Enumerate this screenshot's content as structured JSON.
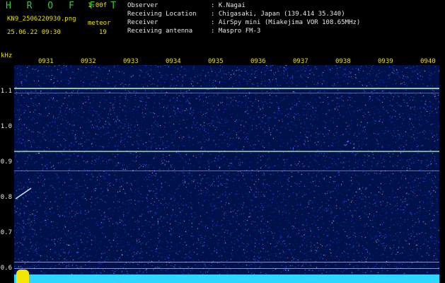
{
  "header": {
    "title": "H R O F F T",
    "version": "1.00f",
    "filename": "KN9_2506220930.png",
    "datetime": "25.06.22 09:30",
    "meteor_label": "meteor",
    "meteor_count": "19"
  },
  "info": [
    {
      "label": "Observer",
      "value": ": K.Nagai"
    },
    {
      "label": "Receiving Location",
      "value": ": Chigasaki, Japan (139.414 35.340)"
    },
    {
      "label": "Receiver",
      "value": ": AirSpy mini (Miakejima VOR 108.65MHz)"
    },
    {
      "label": "Receiving antenna",
      "value": ": Maspro FM-3"
    }
  ],
  "axis": {
    "y_unit": "kHz",
    "y_ticks": [
      "1.1",
      "1.0",
      "0.9",
      "0.8",
      "0.7",
      "0.6"
    ],
    "x_ticks": [
      "0931",
      "0932",
      "0933",
      "0934",
      "0935",
      "0936",
      "0937",
      "0938",
      "0939",
      "0940"
    ]
  },
  "colors": {
    "background": "#000000",
    "spectrogram": "#00104a",
    "signal_line": "#9fe8c0",
    "noise_band": "#2fd6ff",
    "meteor_burst": "#f4e600",
    "label_yellow": "#e8e000",
    "title_green": "#33cc33"
  }
}
